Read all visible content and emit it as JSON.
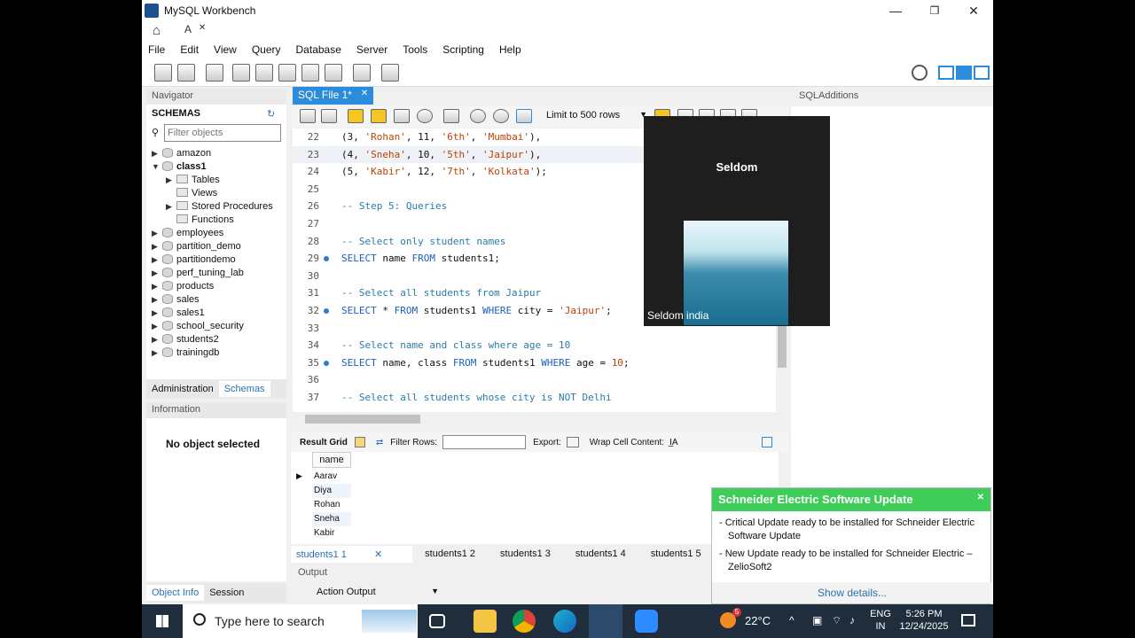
{
  "window": {
    "title": "MySQL Workbench",
    "controls": [
      "—",
      "❐",
      "✕"
    ]
  },
  "conn_tab": {
    "label": "A",
    "close": "✕"
  },
  "menu": [
    "File",
    "Edit",
    "View",
    "Query",
    "Database",
    "Server",
    "Tools",
    "Scripting",
    "Help"
  ],
  "navigator": {
    "title": "Navigator",
    "schemas_label": "SCHEMAS",
    "filter_placeholder": "Filter objects",
    "tree": [
      {
        "label": "amazon",
        "open": false
      },
      {
        "label": "class1",
        "open": true,
        "bold": true
      },
      {
        "label": "Tables",
        "child": true,
        "arrow": true
      },
      {
        "label": "Views",
        "child": true
      },
      {
        "label": "Stored Procedures",
        "child": true,
        "arrow": true
      },
      {
        "label": "Functions",
        "child": true
      },
      {
        "label": "employees"
      },
      {
        "label": "partition_demo"
      },
      {
        "label": "partitiondemo"
      },
      {
        "label": "perf_tuning_lab"
      },
      {
        "label": "products"
      },
      {
        "label": "sales"
      },
      {
        "label": "sales1"
      },
      {
        "label": "school_security"
      },
      {
        "label": "students2"
      },
      {
        "label": "trainingdb"
      }
    ],
    "bottom_tabs": [
      "Administration",
      "Schemas"
    ],
    "information_label": "Information",
    "no_object": "No object selected",
    "obj_tabs": [
      "Object Info",
      "Session"
    ]
  },
  "editor": {
    "tab_label": "SQL File 1*",
    "limit_label": "Limit to 500 rows",
    "lines": [
      {
        "n": "22",
        "code": "(3, 'Rohan', 11, '6th', 'Mumbai'),",
        "kind": "data"
      },
      {
        "n": "23",
        "code": "(4, 'Sneha', 10, '5th', 'Jaipur'),",
        "kind": "data",
        "hl": true
      },
      {
        "n": "24",
        "code": "(5, 'Kabir', 12, '7th', 'Kolkata');",
        "kind": "data"
      },
      {
        "n": "25",
        "code": "",
        "kind": "blank"
      },
      {
        "n": "26",
        "code": "-- Step 5: Queries",
        "kind": "comment"
      },
      {
        "n": "27",
        "code": "",
        "kind": "blank"
      },
      {
        "n": "28",
        "code": "-- Select only student names",
        "kind": "comment"
      },
      {
        "n": "29",
        "code": "SELECT name FROM students1;",
        "kind": "sql",
        "dot": true
      },
      {
        "n": "30",
        "code": "",
        "kind": "blank"
      },
      {
        "n": "31",
        "code": "-- Select all students from Jaipur",
        "kind": "comment"
      },
      {
        "n": "32",
        "code": "SELECT * FROM students1 WHERE city = 'Jaipur';",
        "kind": "sql",
        "dot": true
      },
      {
        "n": "33",
        "code": "",
        "kind": "blank"
      },
      {
        "n": "34",
        "code": "-- Select name and class where age = 10",
        "kind": "comment"
      },
      {
        "n": "35",
        "code": "SELECT name, class FROM students1 WHERE age = 10;",
        "kind": "sql",
        "dot": true
      },
      {
        "n": "36",
        "code": "",
        "kind": "blank"
      },
      {
        "n": "37",
        "code": "-- Select all students whose city is NOT Delhi",
        "kind": "comment"
      }
    ]
  },
  "result": {
    "toolbar": {
      "grid_label": "Result Grid",
      "filter_label": "Filter Rows:",
      "export_label": "Export:",
      "wrap_label": "Wrap Cell Content:"
    },
    "column": "name",
    "rows": [
      "Aarav",
      "Diya",
      "Rohan",
      "Sneha",
      "Kabir"
    ],
    "tabs": [
      "students1 1",
      "students1 2",
      "students1 3",
      "students1 4",
      "students1 5"
    ],
    "output_label": "Output",
    "action_output": "Action Output"
  },
  "sql_additions": {
    "title": "SQLAdditions"
  },
  "video": {
    "name": "Seldom",
    "caption": "Seldom india"
  },
  "toast": {
    "title": "Schneider Electric Software Update",
    "items": [
      "Critical Update ready to be installed for Schneider Electric Software Update",
      "New Update ready to be installed for Schneider Electric – ZelioSoft2"
    ],
    "show_details": "Show details..."
  },
  "taskbar": {
    "search_placeholder": "Type here to search",
    "weather": "22°C",
    "lang1": "ENG",
    "lang2": "IN",
    "time": "5:26 PM",
    "date": "12/24/2025",
    "weather_badge": "5"
  },
  "colors": {
    "accent": "#2a8cda",
    "toast_green": "#3dcd58",
    "taskbar": "#1f2d3d"
  }
}
